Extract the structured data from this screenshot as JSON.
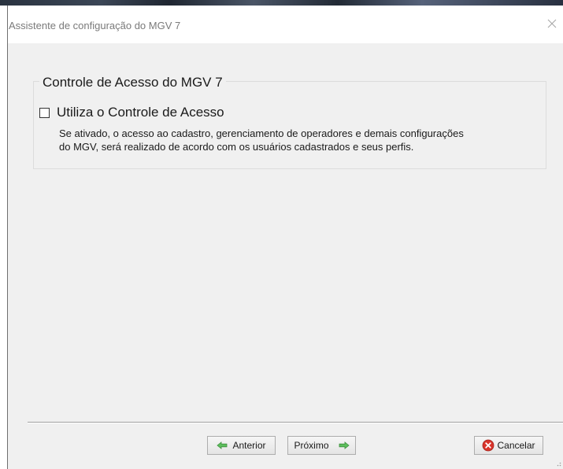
{
  "window": {
    "title": "Assistente de configuração do MGV 7"
  },
  "access_control": {
    "group_title": "Controle de Acesso do MGV 7",
    "checkbox_label": "Utiliza o Controle de Acesso",
    "checkbox_checked": false,
    "description_line1": "Se ativado, o acesso ao cadastro, gerenciamento de operadores e demais configurações",
    "description_line2": "do MGV, será realizado de acordo com os usuários cadastrados e seus perfis."
  },
  "footer": {
    "back_label": "Anterior",
    "next_label": "Próximo",
    "cancel_label": "Cancelar"
  },
  "icons": {
    "close": "close-icon",
    "back": "arrow-left-icon",
    "next": "arrow-right-icon",
    "cancel": "cancel-x-icon"
  },
  "colors": {
    "arrow_green": "#4caf50",
    "cancel_red": "#d9342b",
    "dialog_bg": "#f0f0f0"
  }
}
